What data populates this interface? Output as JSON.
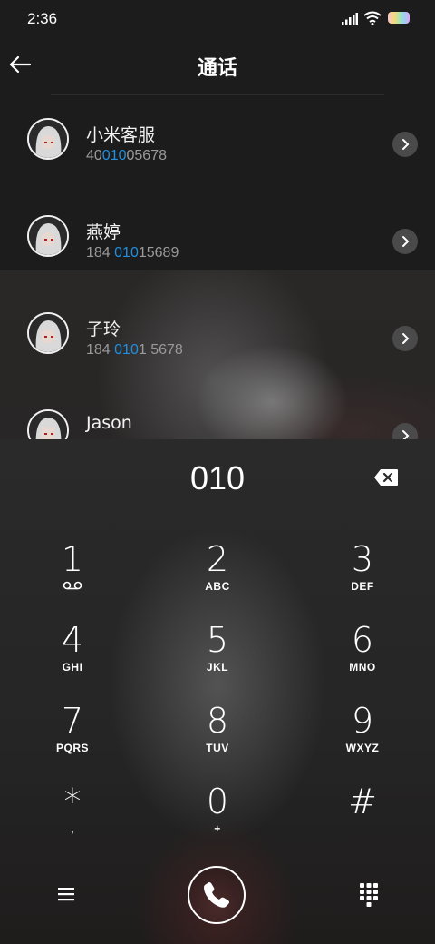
{
  "status_bar": {
    "time": "2:36"
  },
  "header": {
    "title": "通话"
  },
  "contacts": [
    {
      "name": "小米客服",
      "num_pre": "40",
      "num_hl": "010",
      "num_post": "05678"
    },
    {
      "name": "燕婷",
      "num_pre": "184 ",
      "num_hl": "010",
      "num_post": "15689"
    },
    {
      "name": "子玲",
      "num_pre": "184 ",
      "num_hl": "010",
      "num_post": "1 5678"
    },
    {
      "name": "Jason",
      "num_pre": "",
      "num_hl": "",
      "num_post": ""
    }
  ],
  "dialer": {
    "input": "010",
    "keys": [
      {
        "digit": "1",
        "letters": "voicemail-icon"
      },
      {
        "digit": "2",
        "letters": "ABC"
      },
      {
        "digit": "3",
        "letters": "DEF"
      },
      {
        "digit": "4",
        "letters": "GHI"
      },
      {
        "digit": "5",
        "letters": "JKL"
      },
      {
        "digit": "6",
        "letters": "MNO"
      },
      {
        "digit": "7",
        "letters": "PQRS"
      },
      {
        "digit": "8",
        "letters": "TUV"
      },
      {
        "digit": "9",
        "letters": "WXYZ"
      },
      {
        "digit": "*",
        "letters": ","
      },
      {
        "digit": "0",
        "letters": "+"
      },
      {
        "digit": "#",
        "letters": ""
      }
    ]
  },
  "colors": {
    "highlight": "#1f8fe0",
    "background": "#1c1c1c"
  }
}
